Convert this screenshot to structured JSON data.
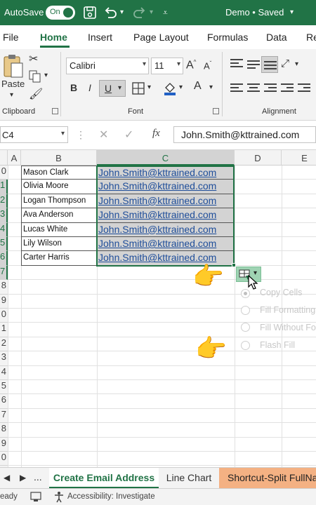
{
  "titlebar": {
    "autosave_label": "AutoSave",
    "toggle_state": "On",
    "doc_title": "Demo • Saved"
  },
  "tabs": [
    "File",
    "Home",
    "Insert",
    "Page Layout",
    "Formulas",
    "Data",
    "Re"
  ],
  "ribbon": {
    "paste_label": "Paste",
    "font_name": "Calibri",
    "font_size": "11",
    "bold": "B",
    "italic": "I",
    "underline": "U",
    "font_color_letter": "A",
    "groups": {
      "clipboard": "Clipboard",
      "font": "Font",
      "alignment": "Alignment"
    }
  },
  "formula_bar": {
    "name_box": "C4",
    "fx": "fx",
    "value": "John.Smith@kttrained.com"
  },
  "columns": [
    "A",
    "B",
    "C",
    "D",
    "E"
  ],
  "row_numbers": [
    "0",
    "1",
    "2",
    "3",
    "4",
    "5",
    "6",
    "7",
    "8",
    "9",
    "0",
    "1",
    "2",
    "3",
    "4",
    "5",
    "6",
    "7",
    "8",
    "9",
    "0",
    "1"
  ],
  "rows": [
    {
      "name": "Mason Clark",
      "email": "John.Smith@kttrained.com"
    },
    {
      "name": "Olivia Moore",
      "email": "John.Smith@kttrained.com"
    },
    {
      "name": "Logan Thompson",
      "email": "John.Smith@kttrained.com"
    },
    {
      "name": "Ava Anderson",
      "email": "John.Smith@kttrained.com"
    },
    {
      "name": "Lucas White",
      "email": "John.Smith@kttrained.com"
    },
    {
      "name": "Lily Wilson",
      "email": "John.Smith@kttrained.com"
    },
    {
      "name": "Carter Harris",
      "email": "John.Smith@kttrained.com"
    }
  ],
  "autofill_menu": [
    "Copy Cells",
    "Fill Formatting Only",
    "Fill Without Formatting",
    "Flash Fill"
  ],
  "sheet_tabs": {
    "ellipsis": "...",
    "active": "Create Email Address",
    "second": "Line Chart",
    "third": "Shortcut-Split FullName"
  },
  "status": {
    "ready": "eady",
    "accessibility": "Accessibility: Investigate"
  },
  "colors": {
    "accent": "#217346",
    "link": "#1f4e9a",
    "tab_orange": "#f4b183"
  }
}
